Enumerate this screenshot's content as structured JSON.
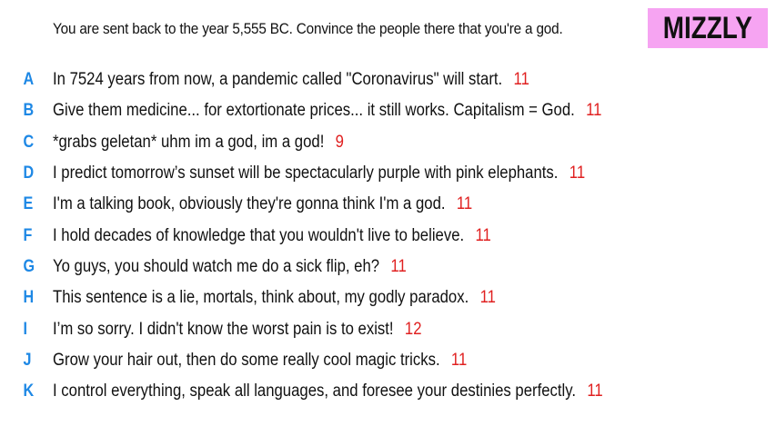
{
  "prompt": "You are sent back to the year 5,555 BC. Convince the people there that you're a god.",
  "brand": "MIZZLY",
  "colors": {
    "letter": "#1e88e5",
    "score": "#e02020",
    "text": "#111111",
    "brand_bg": "#f6a4f2"
  },
  "answers": [
    {
      "letter": "A",
      "text": "In 7524 years from now, a pandemic called \"Coronavirus\" will start.",
      "score": "11"
    },
    {
      "letter": "B",
      "text": "Give them medicine... for extortionate prices... it still works. Capitalism = God.",
      "score": "11"
    },
    {
      "letter": "C",
      "text": "*grabs geletan* uhm im a god, im a god!",
      "score": "9"
    },
    {
      "letter": "D",
      "text": "I predict tomorrow’s sunset will be spectacularly purple with pink elephants.",
      "score": "11"
    },
    {
      "letter": "E",
      "text": "I'm a talking book, obviously they're gonna think I'm a god.",
      "score": "11"
    },
    {
      "letter": "F",
      "text": "I hold decades of knowledge that you wouldn't live to believe.",
      "score": "11"
    },
    {
      "letter": "G",
      "text": "Yo guys, you should watch me do a sick flip, eh?",
      "score": "11"
    },
    {
      "letter": "H",
      "text": "This sentence is a lie, mortals, think about, my godly paradox.",
      "score": "11"
    },
    {
      "letter": "I",
      "text": "I’m so sorry. I didn't know the worst pain is to exist!",
      "score": "12"
    },
    {
      "letter": "J",
      "text": "Grow your hair out, then do some really cool magic tricks.",
      "score": "11"
    },
    {
      "letter": "K",
      "text": "I control everything, speak all languages, and foresee your destinies perfectly.",
      "score": "11"
    }
  ]
}
